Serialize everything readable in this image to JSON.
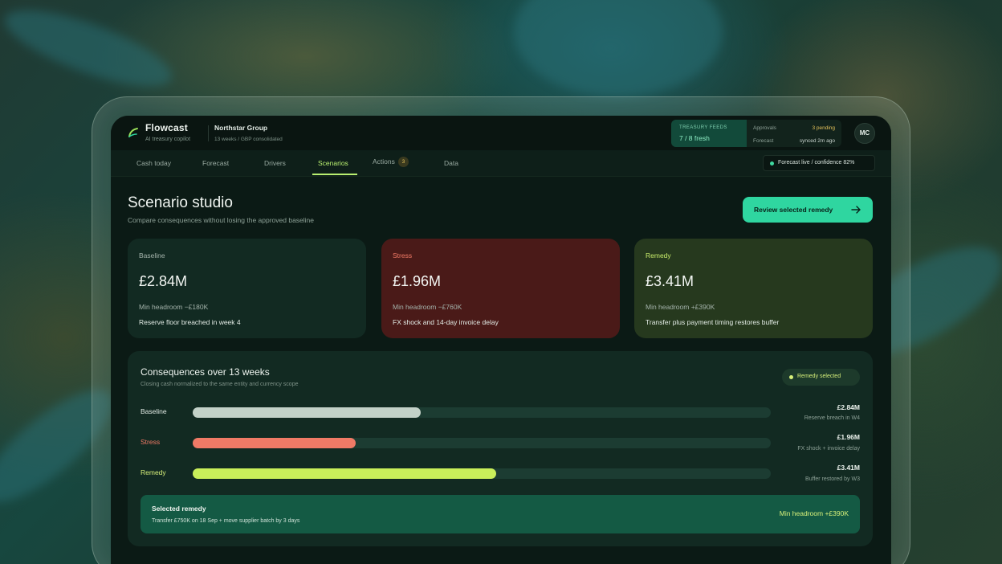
{
  "app": {
    "name": "Flowcast",
    "tagline": "AI treasury copilot",
    "org": "Northstar Group",
    "org_sub": "13 weeks / GBP consolidated",
    "avatar_initials": "MC"
  },
  "feeds": {
    "label": "TREASURY FEEDS",
    "value": "7 / 8 fresh",
    "approvals_label": "Approvals",
    "approvals_value": "3 pending",
    "forecast_label": "Forecast",
    "forecast_value": "synced 2m ago"
  },
  "nav": {
    "tabs": [
      {
        "label": "Cash today"
      },
      {
        "label": "Forecast"
      },
      {
        "label": "Drivers"
      },
      {
        "label": "Scenarios",
        "active": true
      },
      {
        "label": "Actions",
        "badge": "3"
      },
      {
        "label": "Data"
      }
    ],
    "status": "Forecast live  /  confidence 82%"
  },
  "page": {
    "title": "Scenario studio",
    "subtitle": "Compare consequences without losing the approved baseline",
    "primary_button": "Review selected remedy"
  },
  "scenarios": [
    {
      "label": "Baseline",
      "value": "£2.84M",
      "min_headroom": "Min headroom −£180K",
      "note": "Reserve floor breached in week 4",
      "color": "#122a22",
      "label_color": "#a4b3ab"
    },
    {
      "label": "Stress",
      "value": "£1.96M",
      "min_headroom": "Min headroom −£760K",
      "note": "FX shock and 14-day invoice delay",
      "color": "#4a1a18",
      "label_color": "#f27a66"
    },
    {
      "label": "Remedy",
      "value": "£3.41M",
      "min_headroom": "Min headroom +£390K",
      "note": "Transfer plus payment timing restores buffer",
      "color": "#26391e",
      "label_color": "#c8ec6a"
    }
  ],
  "consequences": {
    "title": "Consequences over 13 weeks",
    "subtitle": "Closing cash normalized to the same entity and currency scope",
    "pill": "Remedy selected",
    "rows": [
      {
        "label": "Baseline",
        "value": "£2.84M",
        "note": "Reserve breach in W4",
        "fraction": 0.395,
        "color": "#c3d1c8",
        "label_color": "#e3ece6"
      },
      {
        "label": "Stress",
        "value": "£1.96M",
        "note": "FX shock + invoice delay",
        "fraction": 0.282,
        "color": "#f07a66",
        "label_color": "#f07a66"
      },
      {
        "label": "Remedy",
        "value": "£3.41M",
        "note": "Buffer restored by W3",
        "fraction": 0.525,
        "color": "#c9ef5a",
        "label_color": "#d7f07a"
      }
    ],
    "selected": {
      "title": "Selected remedy",
      "detail": "Transfer £750K on 18 Sep + move supplier batch by 3 days",
      "headroom": "Min headroom +£390K"
    }
  }
}
